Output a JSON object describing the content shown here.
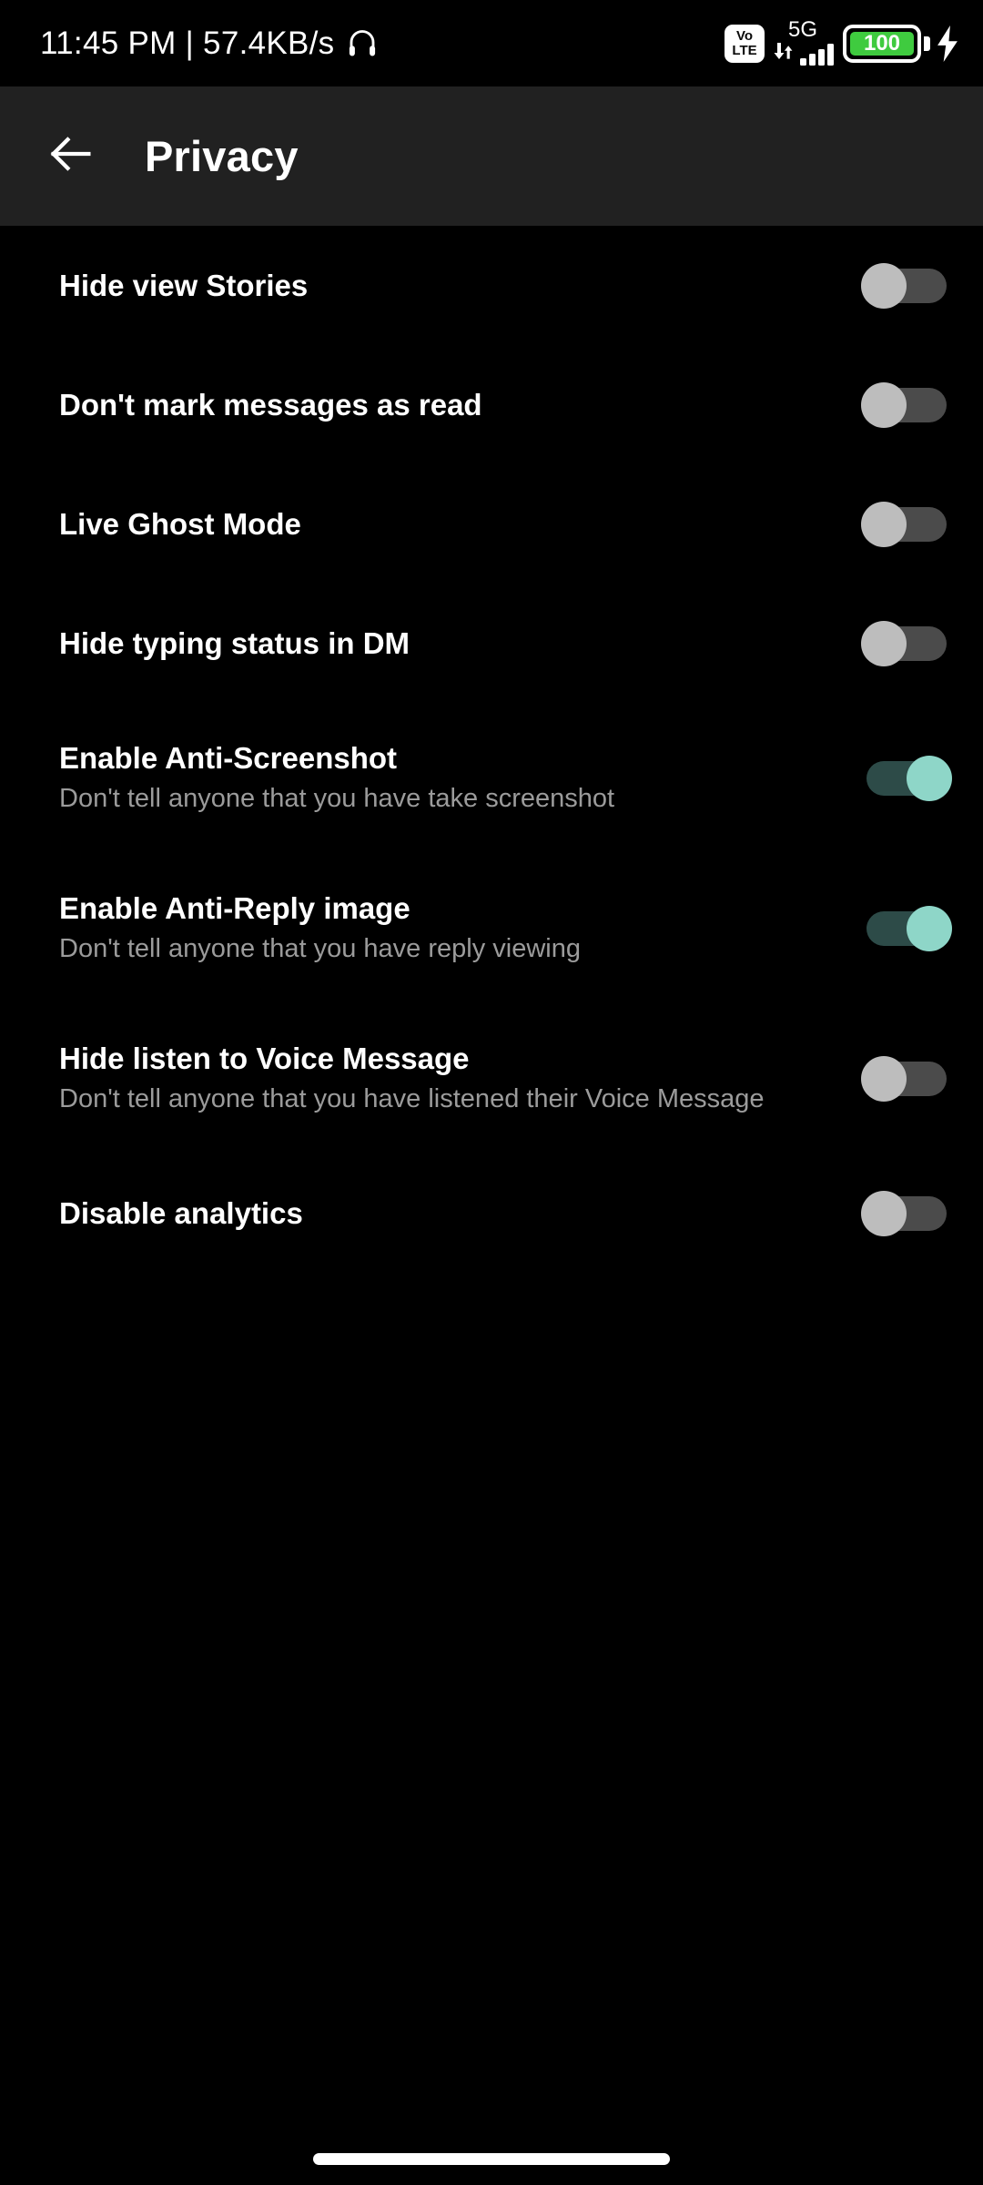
{
  "status_bar": {
    "clock": "11:45 PM | 57.4KB/s",
    "headset_icon": "headphones-icon",
    "volte_line1": "Vo",
    "volte_line2": "LTE",
    "network_type": "5G",
    "signal_icon": "signal-bars-icon",
    "data_arrows_icon": "data-transfer-icon",
    "battery_level": "100",
    "battery_color": "#3fcb3f",
    "charging_icon": "lightning-bolt-icon"
  },
  "header": {
    "back_icon": "arrow-left-icon",
    "title": "Privacy",
    "background": "#212121"
  },
  "settings": {
    "accent_on_thumb": "#8ed6c8",
    "accent_on_track": "#2d4b48",
    "off_thumb": "#bdbdbd",
    "off_track": "#4b4b4b",
    "items": [
      {
        "title": "Hide view Stories",
        "subtitle": "",
        "enabled": false
      },
      {
        "title": "Don't mark messages as read",
        "subtitle": "",
        "enabled": false
      },
      {
        "title": "Live Ghost Mode",
        "subtitle": "",
        "enabled": false
      },
      {
        "title": "Hide typing status in DM",
        "subtitle": "",
        "enabled": false
      },
      {
        "title": "Enable Anti-Screenshot",
        "subtitle": "Don't tell anyone that you have take screenshot",
        "enabled": true
      },
      {
        "title": "Enable Anti-Reply image",
        "subtitle": "Don't tell anyone that you have reply viewing",
        "enabled": true
      },
      {
        "title": "Hide listen to Voice Message",
        "subtitle": "Don't tell anyone that you have listened their Voice Message",
        "enabled": false
      },
      {
        "title": "Disable analytics",
        "subtitle": "",
        "enabled": false
      }
    ]
  },
  "navigation": {
    "gesture_bar": "home-gesture-bar"
  }
}
